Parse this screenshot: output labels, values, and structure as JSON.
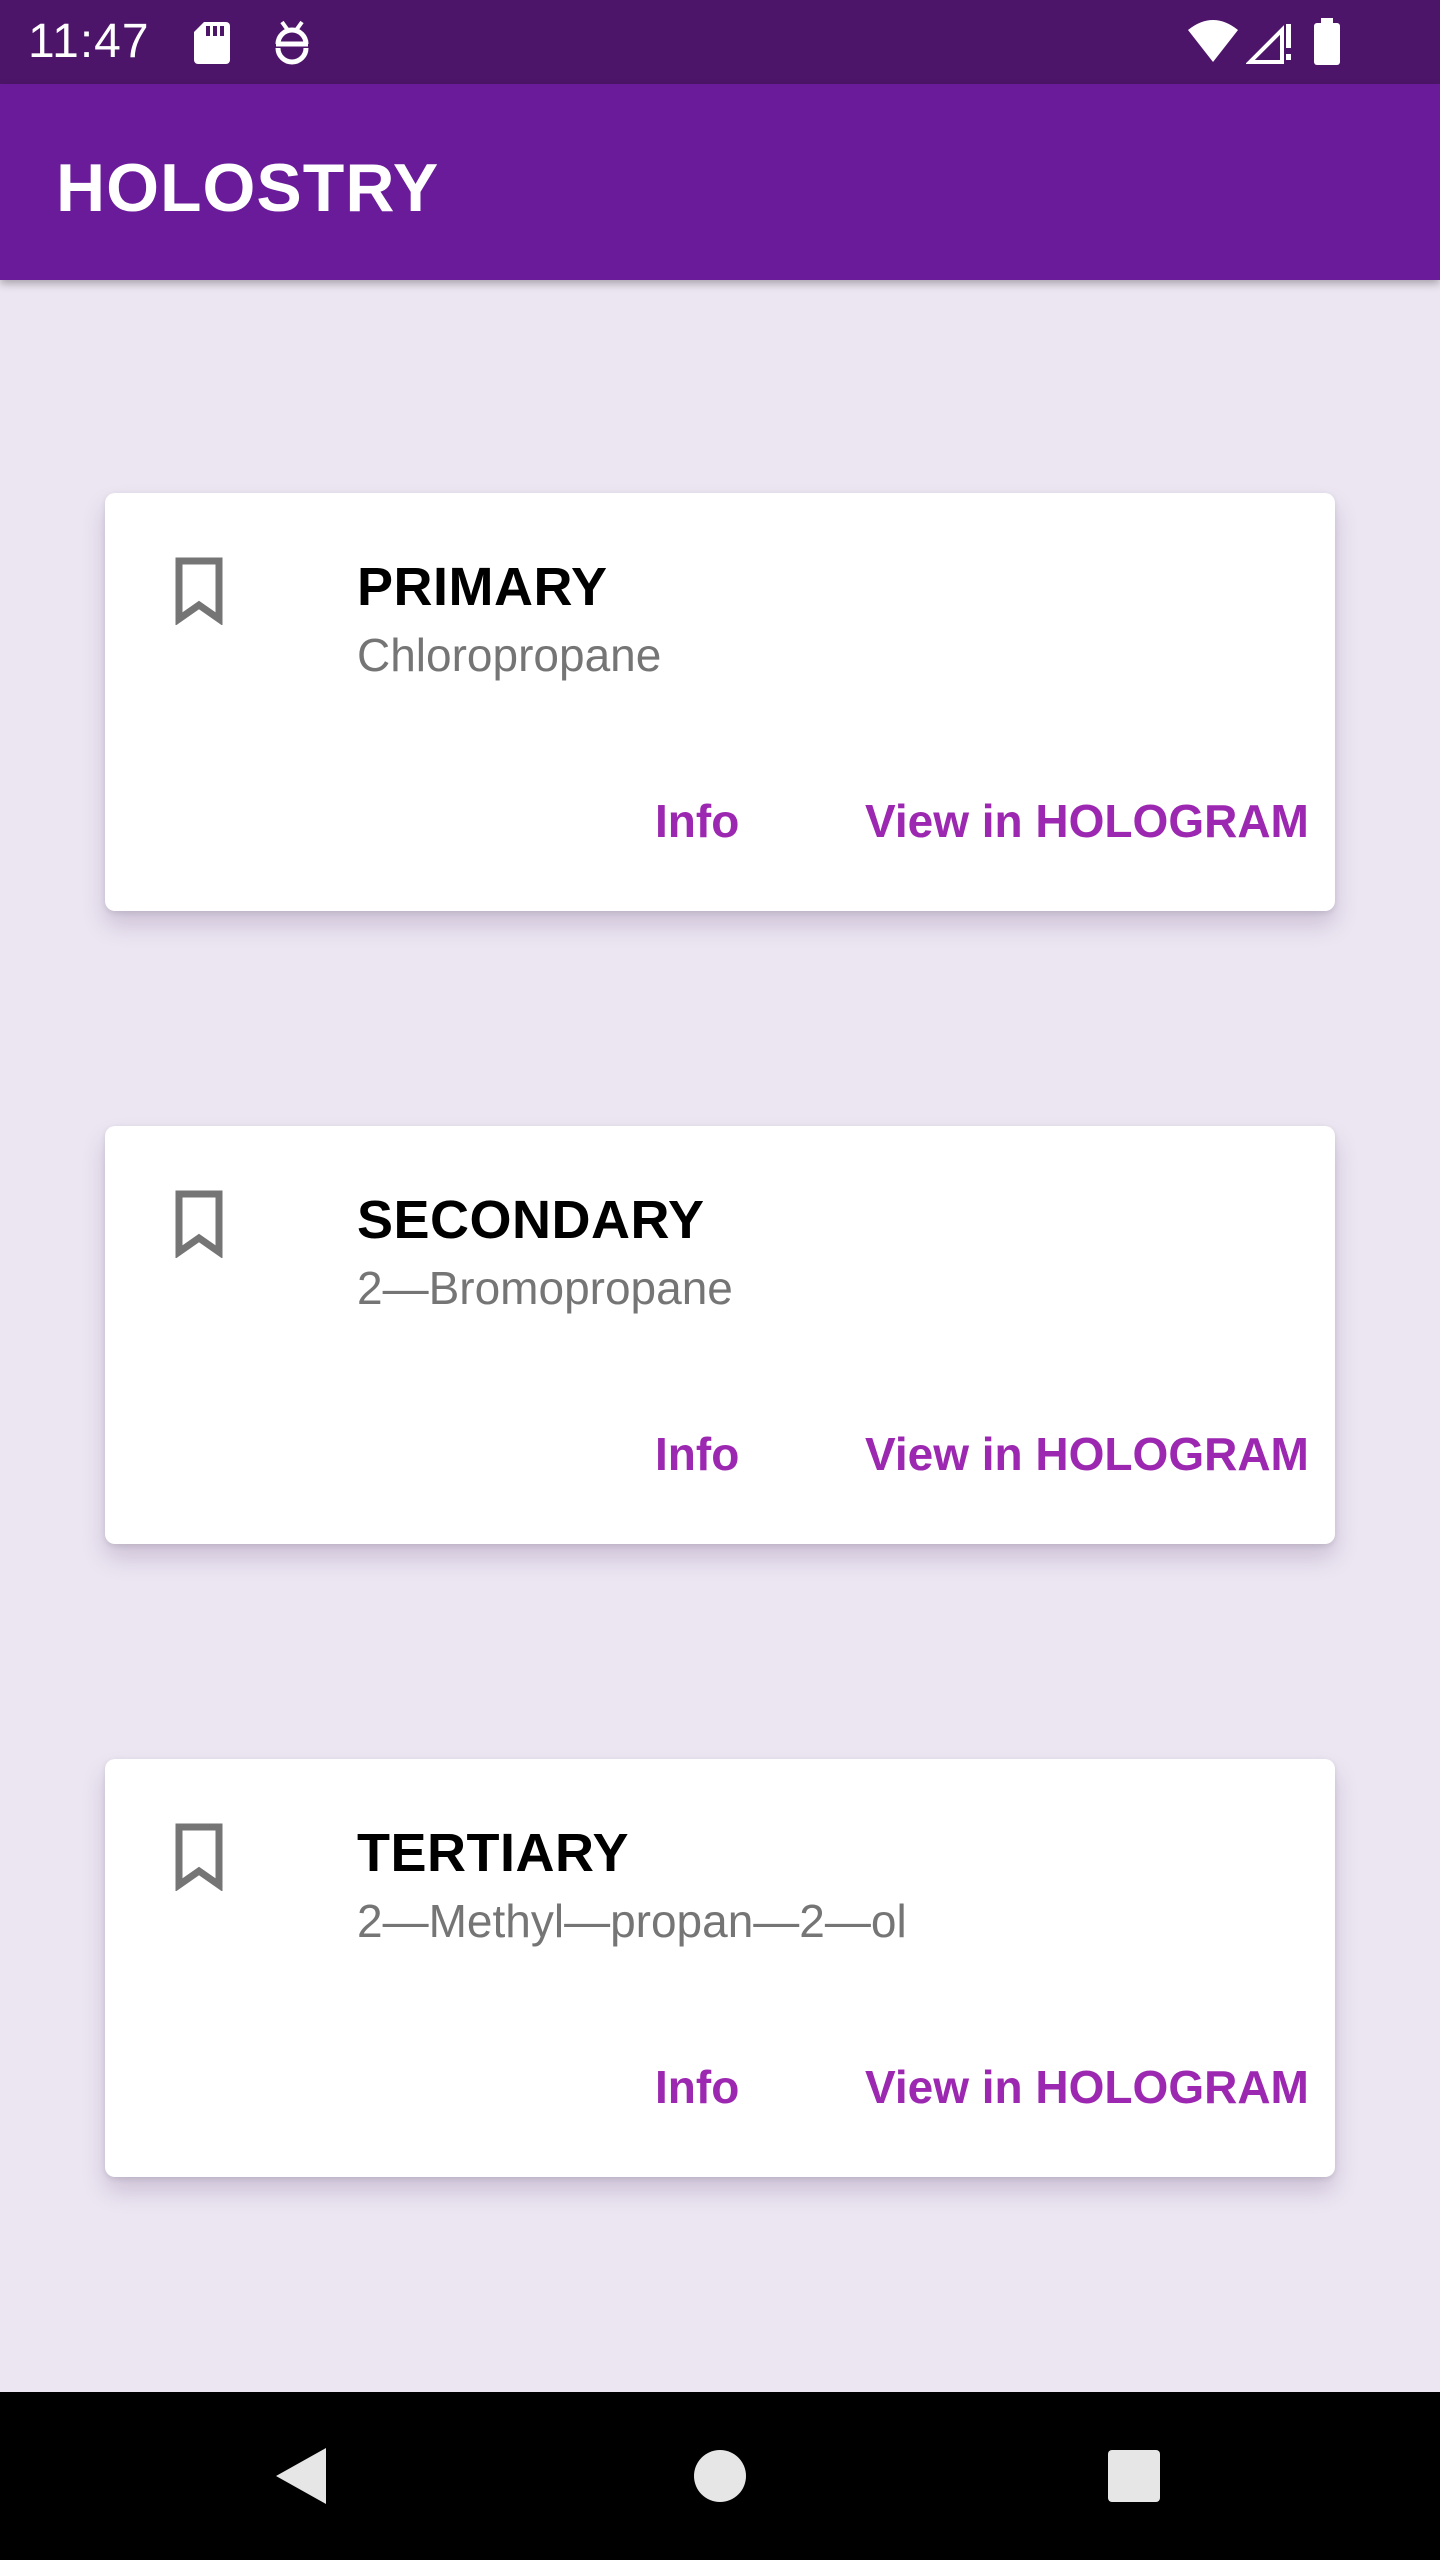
{
  "status_bar": {
    "time": "11:47",
    "icons": [
      "sd-card-icon",
      "android-debug-icon",
      "wifi-icon",
      "signal-icon",
      "battery-icon"
    ]
  },
  "app_bar": {
    "title": "HOLOSTRY",
    "color": "#6A1B9A"
  },
  "cards": [
    {
      "title": "PRIMARY",
      "subtitle": "Chloropropane",
      "info_label": "Info",
      "hologram_label": "View in HOLOGRAM",
      "icon": "bookmark-icon"
    },
    {
      "title": "SECONDARY",
      "subtitle": "2—Bromopropane",
      "info_label": "Info",
      "hologram_label": "View in HOLOGRAM",
      "icon": "bookmark-icon"
    },
    {
      "title": "TERTIARY",
      "subtitle": "2—Methyl—propan—2—ol",
      "info_label": "Info",
      "hologram_label": "View in HOLOGRAM",
      "icon": "bookmark-icon"
    }
  ],
  "nav_bar": {
    "icons": [
      "back-icon",
      "home-icon",
      "recents-icon"
    ]
  },
  "colors": {
    "accent": "#9C27B0",
    "status_bar": "#4D1569",
    "background": "#ECE6F2"
  }
}
